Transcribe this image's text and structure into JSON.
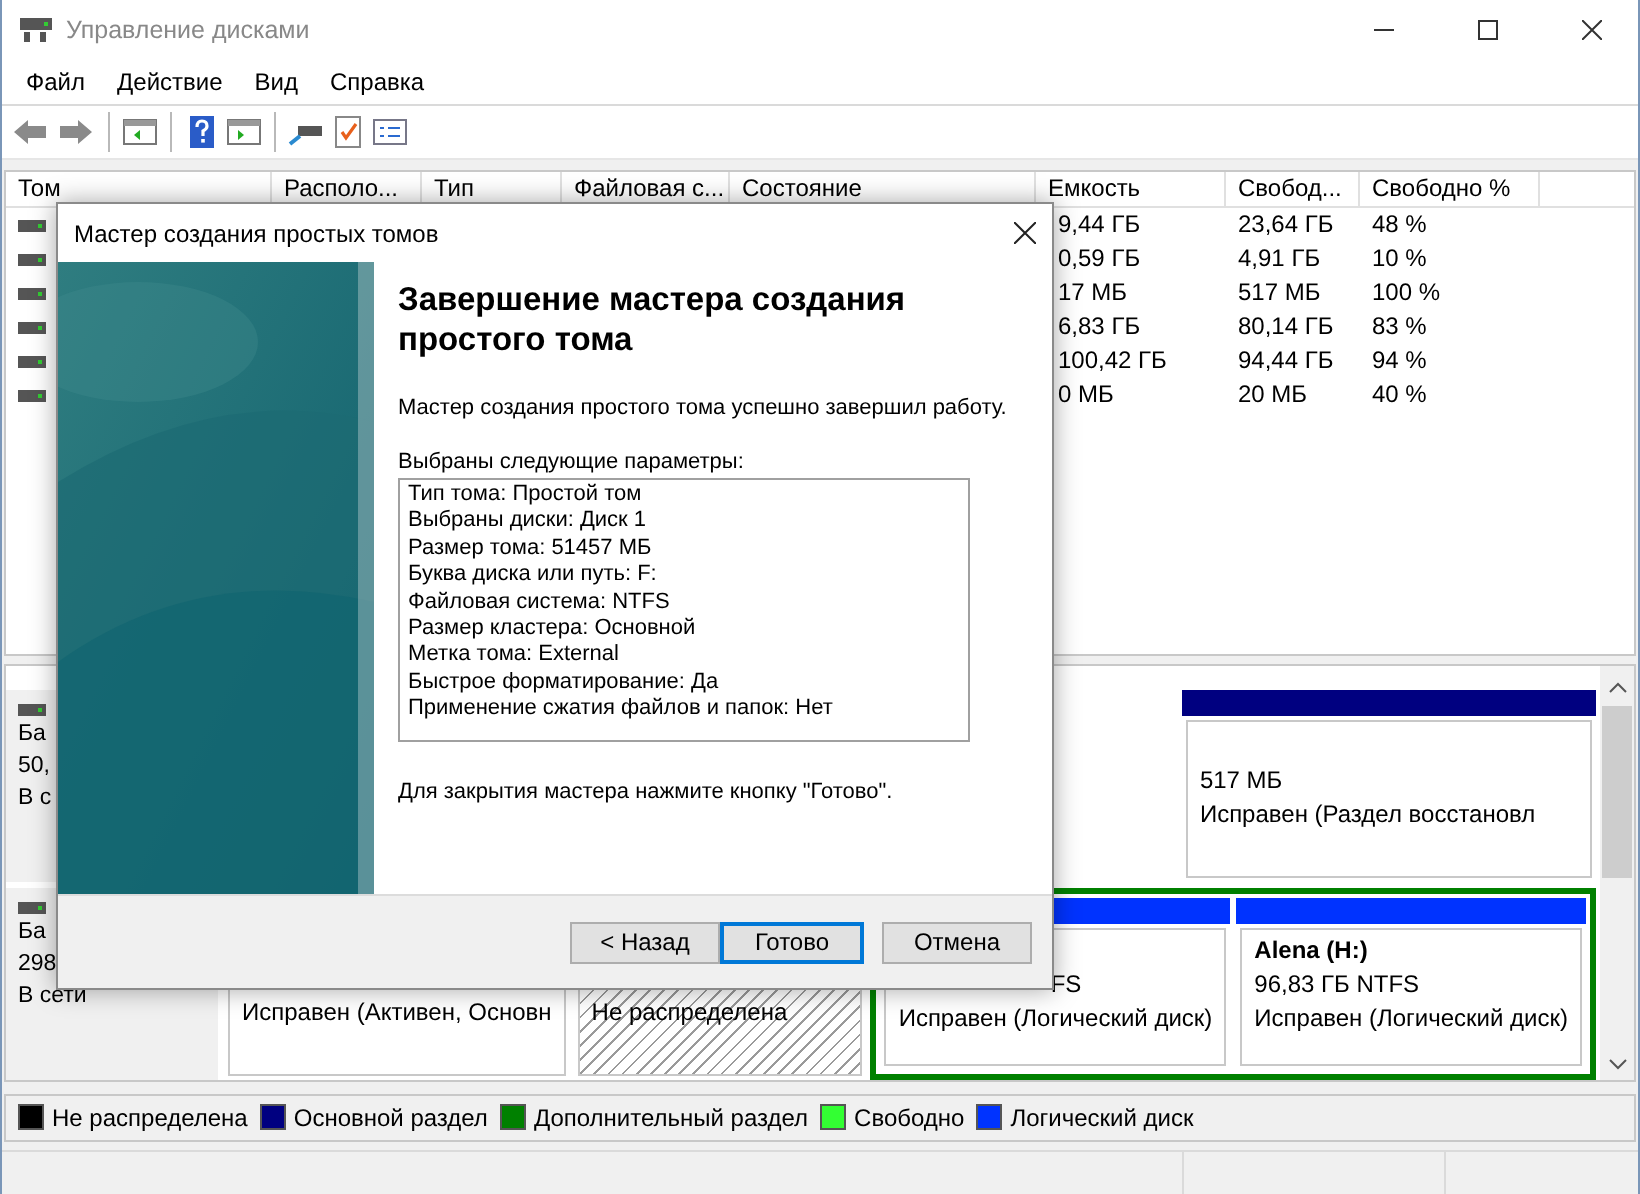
{
  "window": {
    "title": "Управление дисками"
  },
  "menu": [
    "Файл",
    "Действие",
    "Вид",
    "Справка"
  ],
  "table": {
    "columns": [
      "Том",
      "Располо...",
      "Тип",
      "Файловая с...",
      "Состояние",
      "Емкость",
      "Свобод...",
      "Свободно %"
    ],
    "rows": [
      {
        "capacity": "9,44 ГБ",
        "free": "23,64 ГБ",
        "free_pct": "48 %"
      },
      {
        "capacity": "0,59 ГБ",
        "free": "4,91 ГБ",
        "free_pct": "10 %"
      },
      {
        "capacity": "17 МБ",
        "free": "517 МБ",
        "free_pct": "100 %"
      },
      {
        "capacity": "6,83 ГБ",
        "free": "80,14 ГБ",
        "free_pct": "83 %"
      },
      {
        "capacity": "100,42 ГБ",
        "free": "94,44 ГБ",
        "free_pct": "94 %"
      },
      {
        "capacity": "0 МБ",
        "free": "20 МБ",
        "free_pct": "40 %"
      }
    ]
  },
  "disks": [
    {
      "labels": [
        "Ба",
        "50,",
        "В с"
      ],
      "partitions": [
        {
          "kind": "hidden"
        },
        {
          "kind": "primary",
          "lines": [
            {
              "kind": "plain",
              "text": "517 МБ"
            },
            {
              "kind": "plain",
              "text": "Исправен (Раздел восстановл"
            }
          ]
        }
      ]
    },
    {
      "labels": [
        "Ба",
        "298",
        "В сети"
      ],
      "partitions": [
        {
          "kind": "primary",
          "lines": [
            {
              "kind": "plain",
              "text": "Исправен (Активен, Основн"
            }
          ]
        },
        {
          "kind": "unallocated",
          "lines": [
            {
              "kind": "plain",
              "text": "Не распределена"
            }
          ]
        },
        {
          "kind": "extended",
          "children": [
            {
              "kind": "logical",
              "lines": [
                {
                  "kind": "tail",
                  "text": "FS"
                },
                {
                  "kind": "plain",
                  "text": "Исправен (Логический диск)"
                }
              ]
            },
            {
              "kind": "logical",
              "lines": [
                {
                  "kind": "name",
                  "text": "Alena  (H:)"
                },
                {
                  "kind": "plain",
                  "text": "96,83 ГБ NTFS"
                },
                {
                  "kind": "plain",
                  "text": "Исправен (Логический диск)"
                }
              ]
            }
          ]
        }
      ]
    }
  ],
  "legend": [
    {
      "label": "Не распределена",
      "color": "#000000"
    },
    {
      "label": "Основной раздел",
      "color": "#000080"
    },
    {
      "label": "Дополнительный раздел",
      "color": "#008000"
    },
    {
      "label": "Свободно",
      "color": "#33ff33"
    },
    {
      "label": "Логический диск",
      "color": "#0033ff"
    }
  ],
  "dialog": {
    "title": "Мастер создания простых томов",
    "heading": "Завершение мастера создания простого тома",
    "message": "Мастер создания простого тома успешно завершил работу.",
    "params_label": "Выбраны следующие параметры:",
    "params": [
      "Тип тома: Простой том",
      "Выбраны диски: Диск 1",
      "Размер тома: 51457 МБ",
      "Буква диска или путь: F:",
      "Файловая система: NTFS",
      "Размер кластера: Основной",
      "Метка тома: External",
      "Быстрое форматирование: Да",
      "Применение сжатия файлов и папок: Нет"
    ],
    "footer_note": "Для закрытия мастера нажмите кнопку \"Готово\".",
    "buttons": [
      {
        "label": "< Назад",
        "default": false
      },
      {
        "label": "Готово",
        "default": true
      },
      {
        "label": "Отмена",
        "default": false
      }
    ]
  }
}
